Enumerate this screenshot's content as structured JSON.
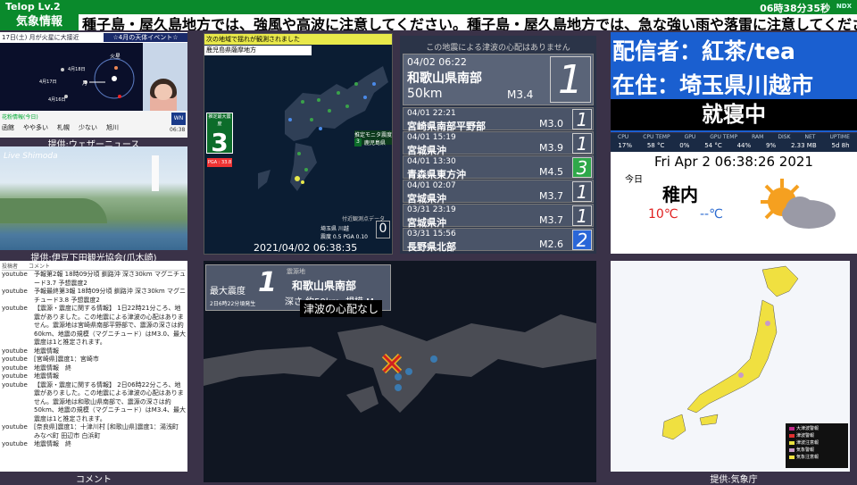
{
  "topbar": {
    "title": "Telop Lv.2",
    "time": "06時38分35秒",
    "logo": "NDX"
  },
  "ticker": {
    "tag": "気象情報",
    "text": "種子島・屋久島地方では、強風や高波に注意してください。種子島・屋久島地方では、急な強い雨や落雷に注意してください。"
  },
  "weathernews": {
    "top_left": "17日(土) 月が火星に大接近",
    "top_right": "☆4月の天体イベント☆",
    "labels": [
      "火星",
      "4月18日",
      "4月17日",
      "4月16日",
      "月"
    ],
    "pollen_title": "花粉情報(今日)",
    "legend": [
      "函館",
      "やや多い",
      "札幌",
      "少ない",
      "旭川"
    ],
    "logo": "WN",
    "clock": "06:38",
    "caption": "提供:ウェザーニュース"
  },
  "camera": {
    "overlay": "Live Shimoda",
    "caption": "提供:伊豆下田観光協会(爪木崎)"
  },
  "comments": {
    "header": [
      "投稿者",
      "コメント"
    ],
    "rows": [
      {
        "user": "youtube",
        "msg": "予報第2報 18時09分頃 釧路沖 深さ30km マグニチュード3.7 予想震度2"
      },
      {
        "user": "youtube",
        "msg": "予報最終第3報 18時09分頃 釧路沖 深さ30km マグニチュード3.8 予想震度2"
      },
      {
        "user": "youtube",
        "msg": "【震源・震度に関する情報】 1日22時21分ころ、地震がありました。この地震による津波の心配はありません。震源地は宮崎県南部平野部で、震源の深さは約60km、地震の規模（マグニチュード）はM3.0、最大震度は1と推定されます。"
      },
      {
        "user": "youtube",
        "msg": "地震情報"
      },
      {
        "user": "youtube",
        "msg": "[宮崎県]震度1：宮崎市"
      },
      {
        "user": "youtube",
        "msg": "地震情報　終"
      },
      {
        "user": "youtube",
        "msg": "地震情報"
      },
      {
        "user": "youtube",
        "msg": "【震源・震度に関する情報】 2日06時22分ころ、地震がありました。この地震による津波の心配はありません。震源地は和歌山県南部で、震源の深さは約50km、地震の規模（マグニチュード）はM3.4、最大震度は1と推定されます。"
      },
      {
        "user": "youtube",
        "msg": "[奈良県]震度1：十津川村 [和歌山県]震度1：湯浅町 みなべ町 田辺市 白浜町"
      },
      {
        "user": "youtube",
        "msg": "地震情報　終"
      }
    ],
    "caption": "コメント"
  },
  "seismo": {
    "header": "次の地域で揺れが観測されました",
    "region": "鹿児島県薩摩地方",
    "badge_label": "推定最大震度",
    "intensity": "3",
    "pga": "PGA : 33.8",
    "side_label": "推定モニタ震度",
    "side_region": "鹿児島県",
    "side_intensity": "3",
    "station": "付近観測点データ",
    "station_name": "埼玉県 川越",
    "station_values": "震度 0.5  PGA 0.10",
    "station_box": "0",
    "timestamp": "2021/04/02 06:38:35"
  },
  "eqlist": {
    "header": "この地震による津波の心配はありません",
    "latest": {
      "date": "04/02 06:22",
      "place": "和歌山県南部",
      "depth": "50km",
      "mag": "M3.4",
      "int": "1"
    },
    "items": [
      {
        "date": "04/01 22:21",
        "place": "宮崎県南部平野部",
        "mag": "M3.0",
        "int": "1",
        "color": "#4a5468"
      },
      {
        "date": "04/01 15:19",
        "place": "宮城県沖",
        "mag": "M3.9",
        "int": "1",
        "color": "#4a5468"
      },
      {
        "date": "04/01 13:30",
        "place": "青森県東方沖",
        "mag": "M4.5",
        "int": "3",
        "color": "#2fa84a"
      },
      {
        "date": "04/01 02:07",
        "place": "宮城県沖",
        "mag": "M3.7",
        "int": "1",
        "color": "#4a5468"
      },
      {
        "date": "03/31 23:19",
        "place": "宮城県沖",
        "mag": "M3.7",
        "int": "1",
        "color": "#4a5468"
      },
      {
        "date": "03/31 15:56",
        "place": "長野県北部",
        "mag": "M2.6",
        "int": "2",
        "color": "#2a66d8"
      }
    ]
  },
  "broadcaster": {
    "line1": "配信者：紅茶/tea",
    "line2": "在住：埼玉県川越市",
    "status": "就寝中"
  },
  "meter": {
    "labels": [
      "CPU",
      "CPU TEMP",
      "GPU",
      "GPU TEMP",
      "RAM",
      "DISK",
      "NET",
      "UPTIME"
    ],
    "values": [
      "17%",
      "58 °C",
      "0%",
      "54 °C",
      "44%",
      "9%",
      "2.33 MB",
      "5d 8h"
    ]
  },
  "weather": {
    "clock": "Fri Apr  2 06:38:26 2021",
    "today": "今日",
    "city": "稚内",
    "hi": "10℃",
    "lo": "--℃"
  },
  "quake": {
    "max_label": "最大震度",
    "max_int": "1",
    "time": "2日6時22分頃発生",
    "epic_label": "震源地",
    "place": "和歌山県南部",
    "depth": "深さ 約50km",
    "scale": "規模 M 3.4",
    "tsunami": "津波の心配なし"
  },
  "jmap": {
    "caption": "提供:気象庁",
    "legend": [
      "大津波警報",
      "津波警報",
      "津波注意報",
      "気象警報",
      "気象注意報"
    ]
  }
}
